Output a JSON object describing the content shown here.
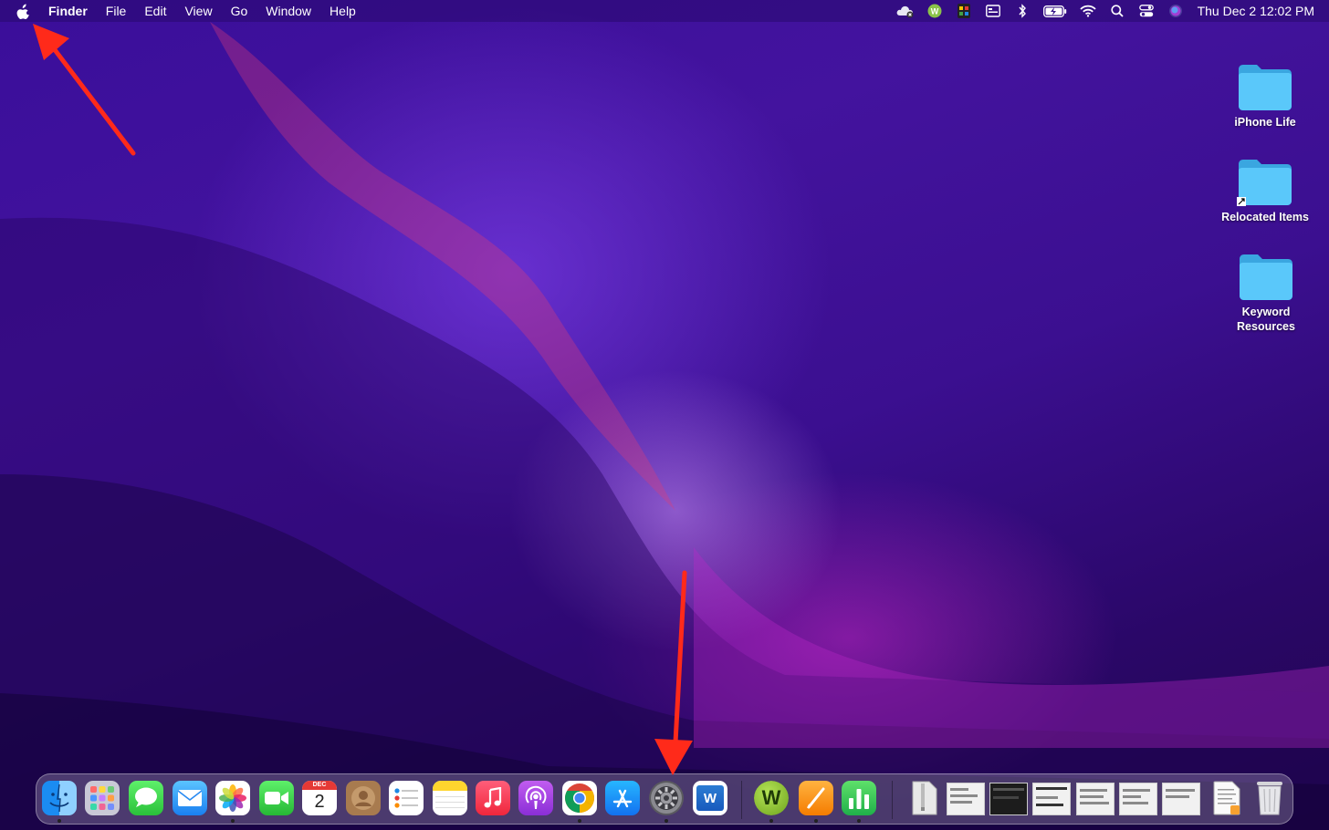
{
  "menubar": {
    "app_name": "Finder",
    "items": [
      "File",
      "Edit",
      "View",
      "Go",
      "Window",
      "Help"
    ],
    "clock": "Thu Dec 2  12:02 PM",
    "status_icons": [
      "creative-cloud-icon",
      "grammarly-icon",
      "istat-icon",
      "display-icon",
      "bluetooth-icon",
      "battery-icon",
      "wifi-icon",
      "spotlight-search-icon",
      "control-center-icon",
      "siri-icon"
    ]
  },
  "desktop": {
    "items": [
      {
        "label": "iPhone Life",
        "icon": "folder-icon"
      },
      {
        "label": "Relocated Items",
        "icon": "folder-alias-icon"
      },
      {
        "label": "Keyword Resources",
        "icon": "folder-icon"
      }
    ]
  },
  "dock": {
    "calendar": {
      "month": "DEC",
      "day": "2"
    },
    "word_letter": "W",
    "wunderlist_letter": "W",
    "apps": [
      "Finder",
      "Launchpad",
      "Messages",
      "Mail",
      "Photos",
      "FaceTime",
      "Calendar",
      "Contacts",
      "Reminders",
      "Notes",
      "Music",
      "Podcasts",
      "Google Chrome",
      "App Store",
      "System Preferences",
      "Microsoft Word",
      "Wunderlist",
      "Pages",
      "Numbers"
    ],
    "trash": "Trash"
  },
  "annotations": {
    "arrow_color": "#ff2a1a",
    "targets": [
      "apple-menu-icon",
      "system-preferences-icon"
    ]
  },
  "colors": {
    "folder": "#5ac8fa",
    "accent": "#ff2a1a"
  }
}
